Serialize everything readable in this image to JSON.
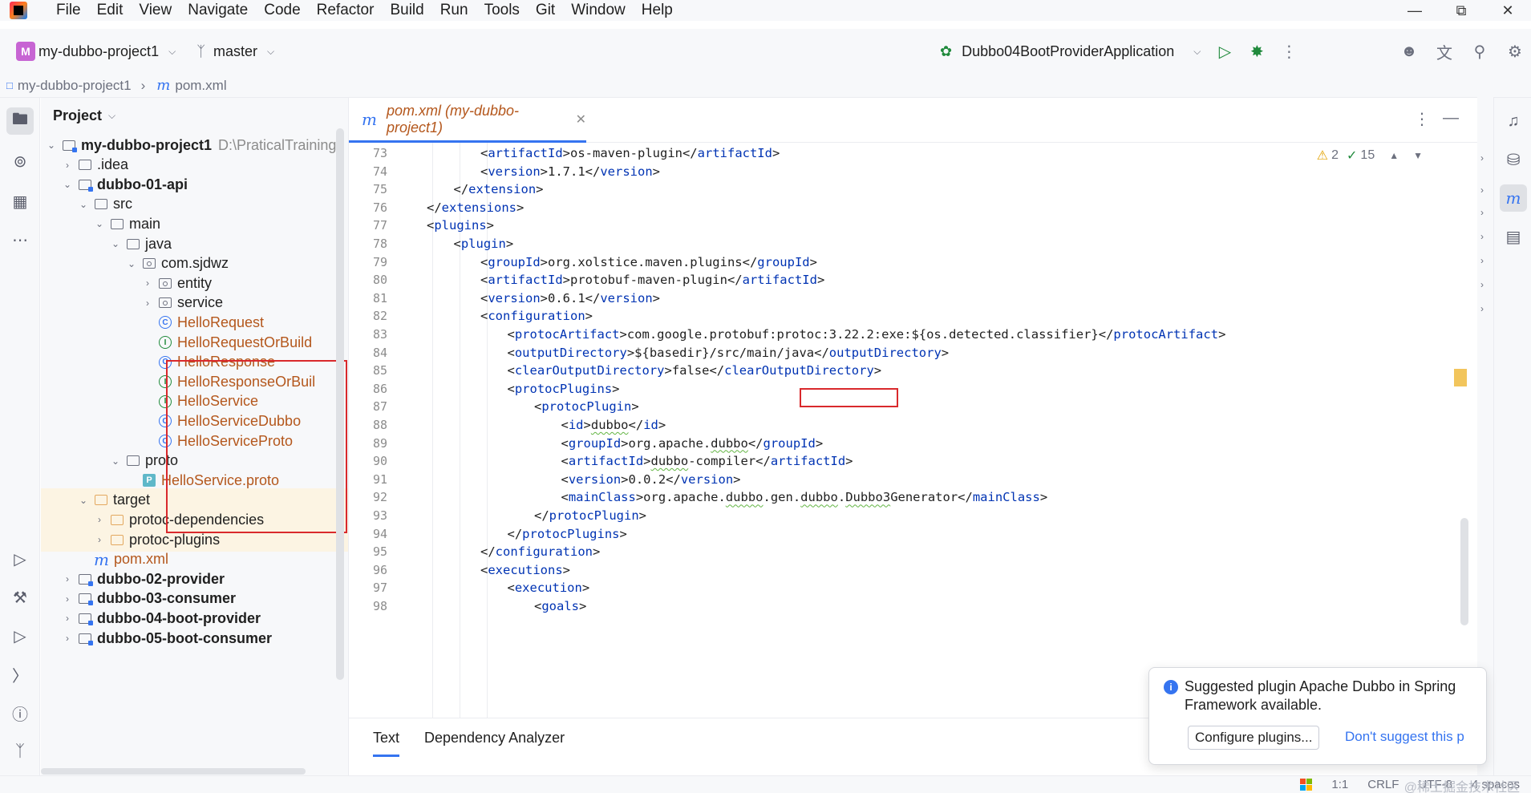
{
  "menubar": {
    "items": [
      "File",
      "Edit",
      "View",
      "Navigate",
      "Code",
      "Refactor",
      "Build",
      "Run",
      "Tools",
      "Git",
      "Window",
      "Help"
    ]
  },
  "toolbar": {
    "project_initial": "M",
    "project_name": "my-dubbo-project1",
    "branch": "master",
    "run_config": "Dubbo04BootProviderApplication"
  },
  "breadcrumb": {
    "project": "my-dubbo-project1",
    "file": "pom.xml"
  },
  "project_panel": {
    "title": "Project",
    "tree": [
      {
        "label": "my-dubbo-project1",
        "path": "D:\\PraticalTraining",
        "icon": "module-icon",
        "style": "bold",
        "depth": 0,
        "expanded": true
      },
      {
        "label": ".idea",
        "icon": "folder-icon",
        "depth": 1,
        "expanded": false
      },
      {
        "label": "dubbo-01-api",
        "icon": "module-icon",
        "style": "bold",
        "depth": 1,
        "expanded": true
      },
      {
        "label": "src",
        "icon": "folder-icon",
        "depth": 2,
        "expanded": true
      },
      {
        "label": "main",
        "icon": "folder-icon",
        "depth": 3,
        "expanded": true
      },
      {
        "label": "java",
        "icon": "folder-icon",
        "depth": 4,
        "expanded": true
      },
      {
        "label": "com.sjdwz",
        "icon": "package-icon",
        "depth": 5,
        "expanded": true
      },
      {
        "label": "entity",
        "icon": "package-icon",
        "depth": 6,
        "expanded": false
      },
      {
        "label": "service",
        "icon": "package-icon",
        "depth": 6,
        "expanded": false
      },
      {
        "label": "HelloRequest",
        "icon": "class-icon",
        "style": "cls",
        "depth": 6
      },
      {
        "label": "HelloRequestOrBuild",
        "icon": "interface-icon",
        "style": "cls",
        "depth": 6
      },
      {
        "label": "HelloResponse",
        "icon": "class-icon",
        "style": "cls",
        "depth": 6
      },
      {
        "label": "HelloResponseOrBuil",
        "icon": "interface-icon",
        "style": "cls",
        "depth": 6
      },
      {
        "label": "HelloService",
        "icon": "interface-icon",
        "style": "cls",
        "depth": 6
      },
      {
        "label": "HelloServiceDubbo",
        "icon": "class-icon",
        "style": "cls",
        "depth": 6
      },
      {
        "label": "HelloServiceProto",
        "icon": "class-icon",
        "style": "cls",
        "depth": 6
      },
      {
        "label": "proto",
        "icon": "folder-icon",
        "depth": 4,
        "expanded": true
      },
      {
        "label": "HelloService.proto",
        "icon": "proto-file-icon",
        "style": "cls",
        "depth": 5
      },
      {
        "label": "target",
        "icon": "folder-orange-icon",
        "depth": 2,
        "expanded": true,
        "highlight": true
      },
      {
        "label": "protoc-dependencies",
        "icon": "folder-orange-icon",
        "depth": 3,
        "expanded": false,
        "highlight": true
      },
      {
        "label": "protoc-plugins",
        "icon": "folder-orange-icon",
        "depth": 3,
        "expanded": false,
        "highlight": true
      },
      {
        "label": "pom.xml",
        "icon": "maven-icon",
        "depth": 2,
        "style": "cls"
      },
      {
        "label": "dubbo-02-provider",
        "icon": "module-icon",
        "style": "bold",
        "depth": 1,
        "expanded": false
      },
      {
        "label": "dubbo-03-consumer",
        "icon": "module-icon",
        "style": "bold",
        "depth": 1,
        "expanded": false
      },
      {
        "label": "dubbo-04-boot-provider",
        "icon": "module-icon",
        "style": "bold",
        "depth": 1,
        "expanded": false
      },
      {
        "label": "dubbo-05-boot-consumer",
        "icon": "module-icon",
        "style": "bold",
        "depth": 1,
        "expanded": false
      }
    ]
  },
  "editor": {
    "tab_label": "pom.xml (my-dubbo-project1)",
    "warnings": "2",
    "ok_count": "15",
    "lines": [
      {
        "n": "73",
        "indent": 4,
        "text": "<artifactId>os-maven-plugin</artifactId>"
      },
      {
        "n": "74",
        "indent": 4,
        "text": "<version>1.7.1</version>"
      },
      {
        "n": "75",
        "indent": 3,
        "text": "</extension>"
      },
      {
        "n": "76",
        "indent": 2,
        "text": "</extensions>"
      },
      {
        "n": "77",
        "indent": 2,
        "text": "<plugins>"
      },
      {
        "n": "78",
        "indent": 3,
        "text": "<plugin>"
      },
      {
        "n": "79",
        "indent": 4,
        "text": "<groupId>org.xolstice.maven.plugins</groupId>"
      },
      {
        "n": "80",
        "indent": 4,
        "text": "<artifactId>protobuf-maven-plugin</artifactId>"
      },
      {
        "n": "81",
        "indent": 4,
        "text": "<version>0.6.1</version>"
      },
      {
        "n": "82",
        "indent": 4,
        "text": "<configuration>"
      },
      {
        "n": "83",
        "indent": 5,
        "text": "<protocArtifact>com.google.protobuf:protoc:3.22.2:exe:${os.detected.classifier}</protocArtifact>"
      },
      {
        "n": "84",
        "indent": 5,
        "text": "<outputDirectory>${basedir}/src/main/java</outputDirectory>"
      },
      {
        "n": "85",
        "indent": 5,
        "text": "<clearOutputDirectory>false</clearOutputDirectory>"
      },
      {
        "n": "86",
        "indent": 5,
        "text": "<protocPlugins>"
      },
      {
        "n": "87",
        "indent": 6,
        "text": "<protocPlugin>"
      },
      {
        "n": "88",
        "indent": 7,
        "text": "<id>dubbo</id>"
      },
      {
        "n": "89",
        "indent": 7,
        "text": "<groupId>org.apache.dubbo</groupId>"
      },
      {
        "n": "90",
        "indent": 7,
        "text": "<artifactId>dubbo-compiler</artifactId>"
      },
      {
        "n": "91",
        "indent": 7,
        "text": "<version>0.0.2</version>"
      },
      {
        "n": "92",
        "indent": 7,
        "text": "<mainClass>org.apache.dubbo.gen.dubbo.Dubbo3Generator</mainClass>"
      },
      {
        "n": "93",
        "indent": 6,
        "text": "</protocPlugin>"
      },
      {
        "n": "94",
        "indent": 5,
        "text": "</protocPlugins>"
      },
      {
        "n": "95",
        "indent": 4,
        "text": "</configuration>"
      },
      {
        "n": "96",
        "indent": 4,
        "text": "<executions>"
      },
      {
        "n": "97",
        "indent": 5,
        "text": "<execution>"
      },
      {
        "n": "98",
        "indent": 6,
        "text": "<goals>"
      }
    ]
  },
  "bottom_tabs": {
    "text": "Text",
    "dependency": "Dependency Analyzer"
  },
  "notification": {
    "message": "Suggested plugin Apache Dubbo in Spring Framework available.",
    "configure": "Configure plugins...",
    "dismiss": "Don't suggest this p"
  },
  "statusbar": {
    "position": "1:1",
    "line_sep": "CRLF",
    "encoding": "UTF-8",
    "indent": "4 spaces",
    "watermark": "@稀土掘金技术社区"
  },
  "colors": {
    "accent": "#3574f0",
    "xml_tag": "#0033b3",
    "class_name": "#b4571c",
    "annotation_red": "#d9292c"
  }
}
